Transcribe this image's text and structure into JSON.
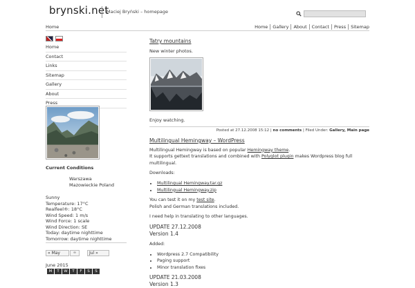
{
  "header": {
    "site_title": "brynski.net",
    "tagline": "Maciej Bryński – homepage",
    "search": {
      "placeholder": ""
    }
  },
  "breadcrumb": {
    "home": "Home"
  },
  "top_nav": [
    "Home",
    "Gallery",
    "About",
    "Contact",
    "Press",
    "Sitemap"
  ],
  "sidebar": {
    "flags": [
      "uk-flag-icon",
      "pl-flag-icon"
    ],
    "menu": [
      "Home",
      "Contact",
      "Links",
      "Sitemap",
      "Gallery",
      "About",
      "Press"
    ],
    "conditions": {
      "title": "Current Conditions",
      "city": "Warszawa",
      "region": "Mazowieckie Poland",
      "lines": [
        "Sunny",
        "Temperature: 17°C",
        "Realfeel®: 18°C",
        "Wind Speed: 1 m/s",
        "Wind Force: 1 scale",
        "Wind Direction: SE",
        "Today: daytime nighttime",
        "Tomorrow: daytime nighttime"
      ]
    },
    "calendar": {
      "prev": "« May",
      "mid": "",
      "next": "Jul »",
      "month": "June 2015",
      "days": [
        "M",
        "T",
        "W",
        "T",
        "F",
        "S",
        "S"
      ]
    }
  },
  "post1": {
    "title": "Tatry mountains",
    "subtitle": "New winter photos.",
    "footer": "Enjoy watching.",
    "meta_prefix": "Posted at 27.12.2008 15:12 |",
    "meta_comments": "no comments",
    "meta_mid": "| Filed Under:",
    "meta_cats": "Gallery, Main page"
  },
  "post2": {
    "title": "Multilingual Hemingway – WordPress",
    "p1_a": "Multilingual Hemingway is based on popular",
    "p1_link": "Hemingway theme",
    "p1_b": ".",
    "p2_a": "It supports gettext translations and combined with",
    "p2_link": "Polyglot plugin",
    "p2_b": "makes Wordpress blog full multilingual.",
    "downloads_label": "Downloads:",
    "downloads": [
      "Multilingual Hemingway.tar.gz",
      "Multilingual Hemingway.zip"
    ],
    "test_a": "You can test it on my",
    "test_link": "test site",
    "test_b": ".",
    "translations": "Polish and German translations included.",
    "help": "I need help in translating to other languages.",
    "update1_title": "UPDATE 27.12.2008",
    "update1_ver": "Version 1.4",
    "added_label": "Added:",
    "added_items": [
      "Wordpress 2.7 Compatibility",
      "Paging support",
      "Minor translation fixes"
    ],
    "update2_title": "UPDATE 21.03.2008",
    "update2_ver": "Version 1.3"
  }
}
